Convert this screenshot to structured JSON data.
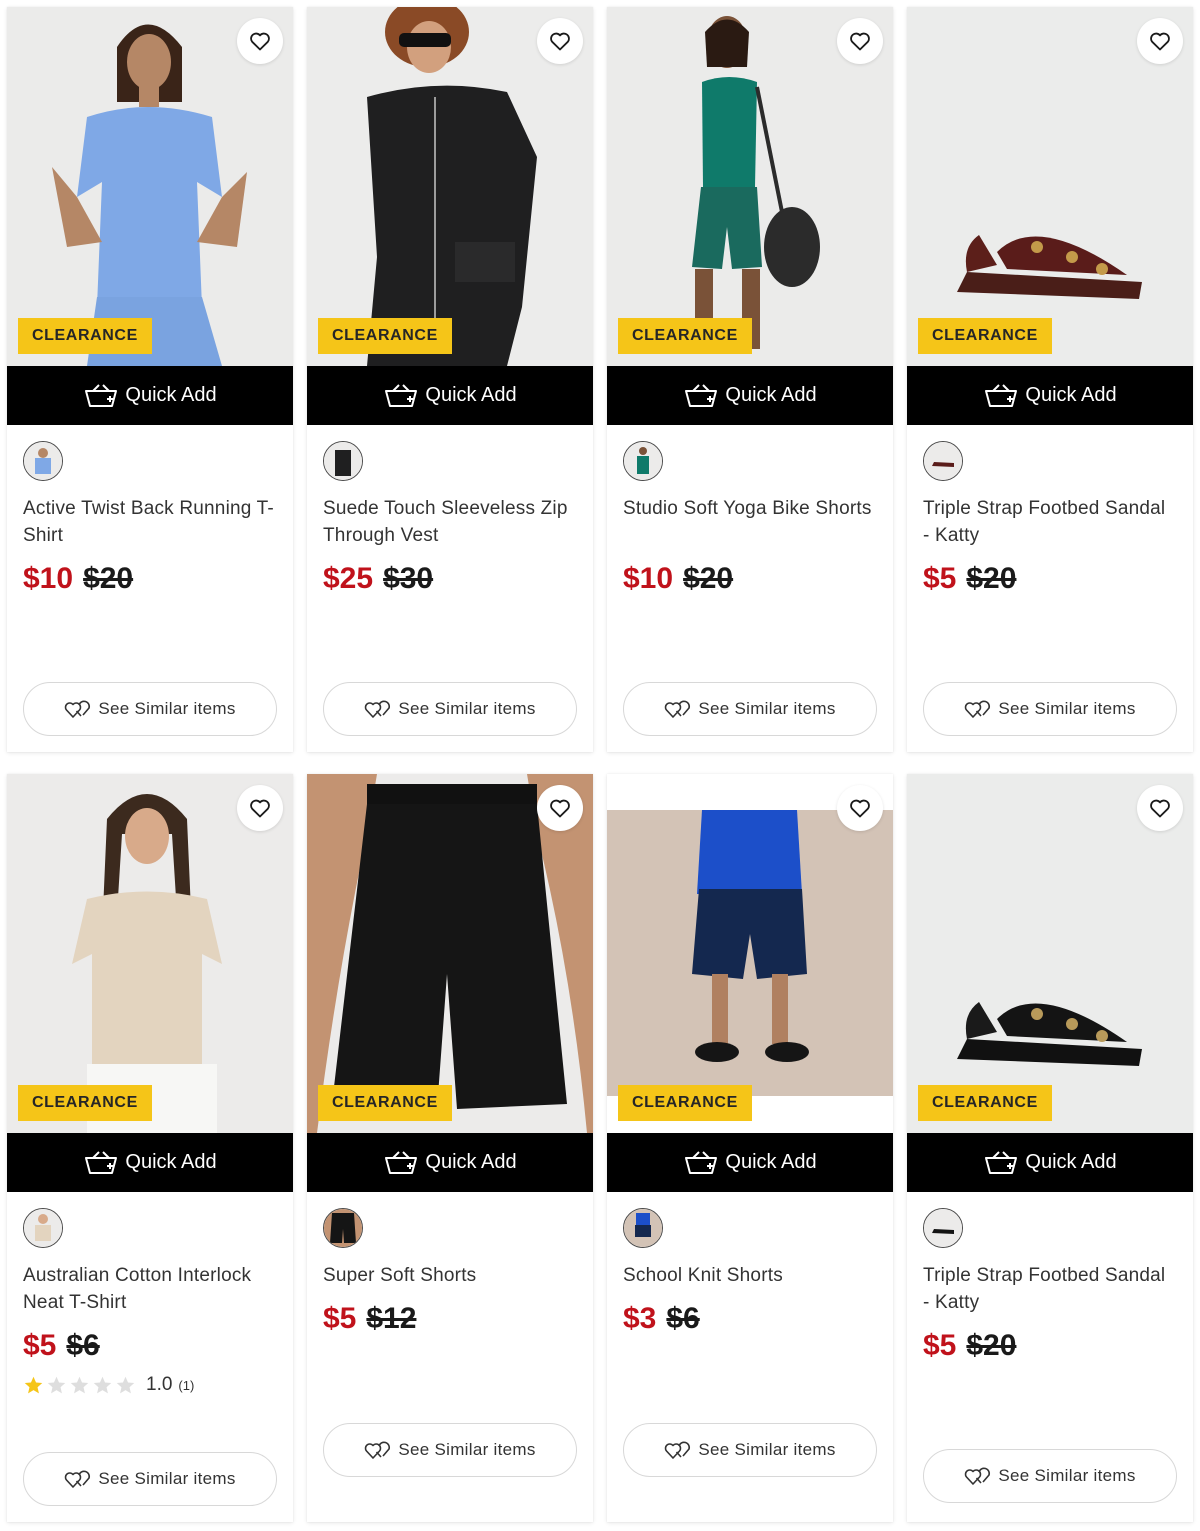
{
  "common": {
    "badge": "CLEARANCE",
    "quick_add": "Quick Add",
    "see_similar": "See Similar items"
  },
  "products": [
    {
      "title": "Active Twist Back Running T-Shirt",
      "price_now": "$10",
      "price_was": "$20"
    },
    {
      "title": "Suede Touch Sleeveless Zip Through Vest",
      "price_now": "$25",
      "price_was": "$30"
    },
    {
      "title": "Studio Soft Yoga Bike Shorts",
      "price_now": "$10",
      "price_was": "$20"
    },
    {
      "title": "Triple Strap Footbed Sandal - Katty",
      "price_now": "$5",
      "price_was": "$20"
    },
    {
      "title": "Australian Cotton Interlock Neat T-Shirt",
      "price_now": "$5",
      "price_was": "$6",
      "rating_value": "1.0",
      "rating_count": "(1)",
      "rating_stars": 1
    },
    {
      "title": "Super Soft Shorts",
      "price_now": "$5",
      "price_was": "$12"
    },
    {
      "title": "School Knit Shorts",
      "price_now": "$3",
      "price_was": "$6"
    },
    {
      "title": "Triple Strap Footbed Sandal - Katty",
      "price_now": "$5",
      "price_was": "$20"
    }
  ],
  "colors": {
    "badge": "#f5c518",
    "sale_price": "#c0121b",
    "quick_add_bg": "#000000"
  }
}
